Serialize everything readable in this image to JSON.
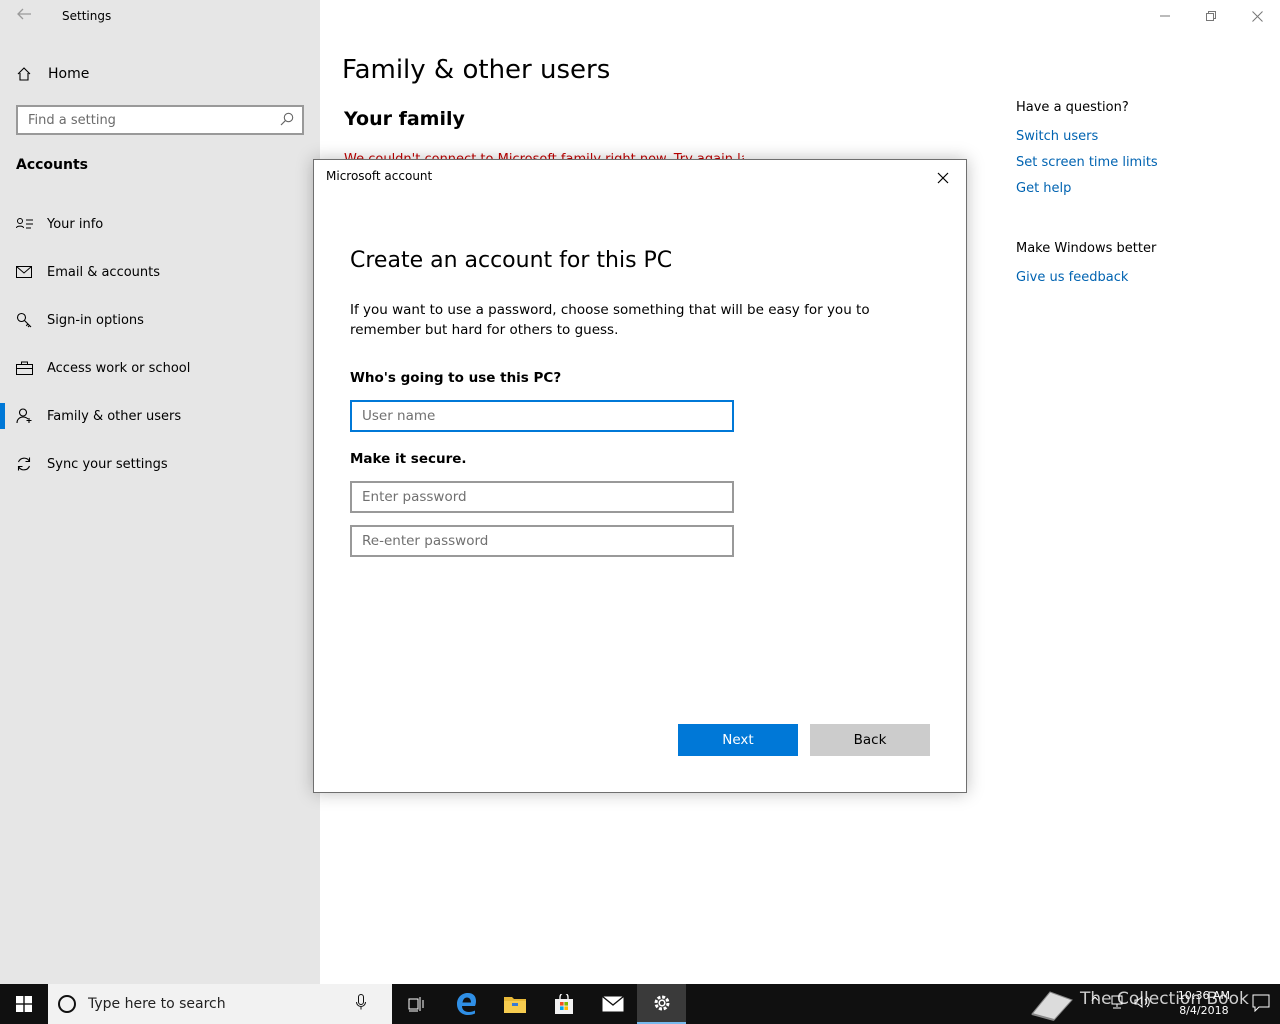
{
  "window": {
    "app_title": "Settings"
  },
  "sidebar": {
    "home_label": "Home",
    "search_placeholder": "Find a setting",
    "section_title": "Accounts",
    "items": [
      {
        "label": "Your info",
        "icon": "person-card-icon"
      },
      {
        "label": "Email & accounts",
        "icon": "mail-icon"
      },
      {
        "label": "Sign-in options",
        "icon": "key-icon"
      },
      {
        "label": "Access work or school",
        "icon": "briefcase-icon"
      },
      {
        "label": "Family & other users",
        "icon": "add-person-icon",
        "active": true
      },
      {
        "label": "Sync your settings",
        "icon": "sync-icon"
      }
    ]
  },
  "main": {
    "title": "Family & other users",
    "subtitle": "Your family",
    "red_text": "We couldn't connect to Microsoft family right now. Try again later."
  },
  "right_panel": {
    "question_heading": "Have a question?",
    "links": [
      "Switch users",
      "Set screen time limits",
      "Get help"
    ],
    "better_heading": "Make Windows better",
    "feedback_link": "Give us feedback"
  },
  "dialog": {
    "title": "Microsoft account",
    "heading": "Create an account for this PC",
    "description": "If you want to use a password, choose something that will be easy for you to remember but hard for others to guess.",
    "who_label": "Who's going to use this PC?",
    "username_placeholder": "User name",
    "secure_label": "Make it secure.",
    "password_placeholder": "Enter password",
    "reenter_placeholder": "Re-enter password",
    "next_label": "Next",
    "back_label": "Back"
  },
  "taskbar": {
    "search_placeholder": "Type here to search",
    "watermark": "The Collection Book",
    "time": "10:36 AM",
    "date": "8/4/2018"
  },
  "colors": {
    "accent": "#0078d7",
    "link": "#0063b1",
    "sidebar_bg": "#e6e6e6",
    "taskbar_bg": "#101010"
  }
}
